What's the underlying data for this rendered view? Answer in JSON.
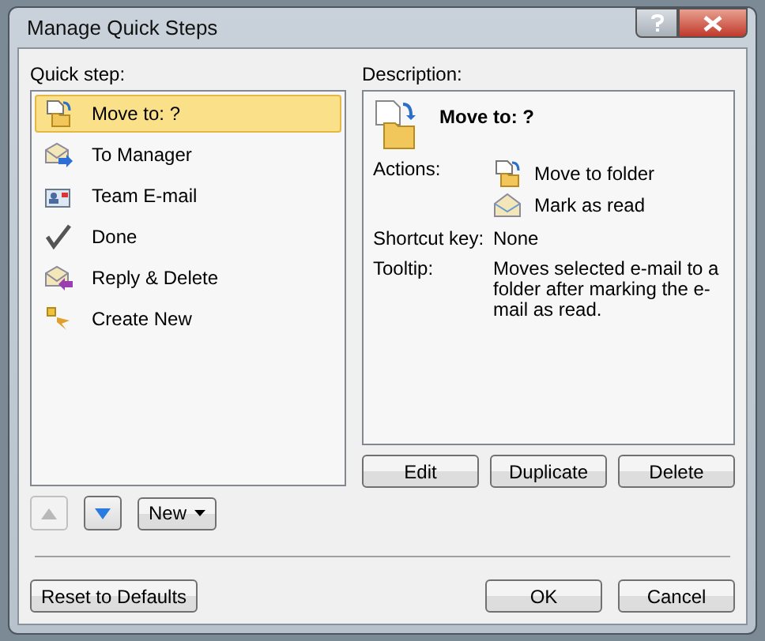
{
  "window": {
    "title": "Manage Quick Steps"
  },
  "quick_steps": {
    "label": "Quick step:",
    "items": [
      {
        "label": "Move to: ?",
        "kind": "move",
        "selected": true
      },
      {
        "label": "To Manager",
        "kind": "forward",
        "selected": false
      },
      {
        "label": "Team E-mail",
        "kind": "team",
        "selected": false
      },
      {
        "label": "Done",
        "kind": "check",
        "selected": false
      },
      {
        "label": "Reply & Delete",
        "kind": "reply",
        "selected": false
      },
      {
        "label": "Create New",
        "kind": "new",
        "selected": false
      }
    ]
  },
  "order_buttons": [
    {
      "kind": "up",
      "disabled": true
    },
    {
      "kind": "down",
      "disabled": false
    }
  ],
  "new_button": {
    "label": "New"
  },
  "description": {
    "label": "Description:",
    "title": "Move to: ?",
    "actions_label": "Actions:",
    "actions": [
      {
        "label": "Move to folder",
        "kind": "move"
      },
      {
        "label": "Mark as read",
        "kind": "read"
      }
    ],
    "shortcut_label": "Shortcut key:",
    "shortcut": "None",
    "tooltip_label": "Tooltip:",
    "tooltip": "Moves selected e-mail to a folder after marking the e-mail as read."
  },
  "description_buttons": [
    "Edit",
    "Duplicate",
    "Delete"
  ],
  "footer_buttons": {
    "reset": "Reset to Defaults",
    "ok": "OK",
    "cancel": "Cancel"
  }
}
